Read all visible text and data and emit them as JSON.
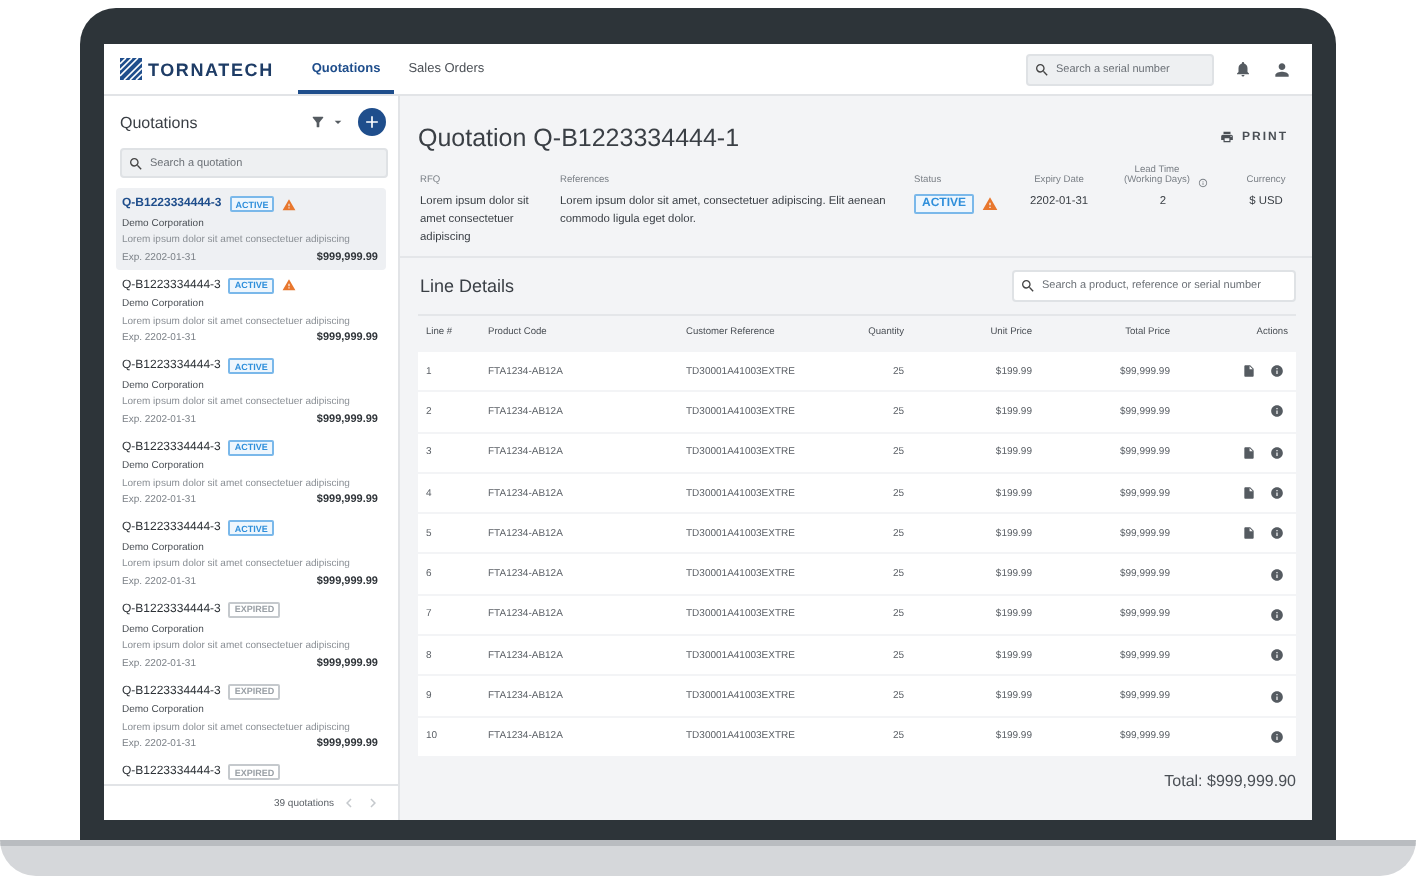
{
  "header": {
    "logo": "TORNATECH",
    "tabs": [
      {
        "label": "Quotations",
        "selected": true
      },
      {
        "label": "Sales Orders",
        "selected": false
      }
    ],
    "search": {
      "placeholder": "Search a serial number"
    }
  },
  "sidebar": {
    "title": "Quotations",
    "search": {
      "placeholder": "Search a quotation"
    },
    "items": [
      {
        "id": "Q-B1223334444-3",
        "status": {
          "kind": "active",
          "label": "ACTIVE"
        },
        "warning": true,
        "selected": true,
        "company": "Demo Corporation",
        "description": "Lorem ipsum dolor sit amet consectetuer adipiscing",
        "expiry": "Exp. 2202-01-31",
        "price": "$999,999.99"
      },
      {
        "id": "Q-B1223334444-3",
        "status": {
          "kind": "active",
          "label": "ACTIVE"
        },
        "warning": true,
        "selected": false,
        "company": "Demo Corporation",
        "description": "Lorem ipsum dolor sit amet consectetuer adipiscing",
        "expiry": "Exp. 2202-01-31",
        "price": "$999,999.99"
      },
      {
        "id": "Q-B1223334444-3",
        "status": {
          "kind": "active",
          "label": "ACTIVE"
        },
        "warning": false,
        "selected": false,
        "company": "Demo Corporation",
        "description": "Lorem ipsum dolor sit amet consectetuer adipiscing",
        "expiry": "Exp. 2202-01-31",
        "price": "$999,999.99"
      },
      {
        "id": "Q-B1223334444-3",
        "status": {
          "kind": "active",
          "label": "ACTIVE"
        },
        "warning": false,
        "selected": false,
        "company": "Demo Corporation",
        "description": "Lorem ipsum dolor sit amet consectetuer adipiscing",
        "expiry": "Exp. 2202-01-31",
        "price": "$999,999.99"
      },
      {
        "id": "Q-B1223334444-3",
        "status": {
          "kind": "active",
          "label": "ACTIVE"
        },
        "warning": false,
        "selected": false,
        "company": "Demo Corporation",
        "description": "Lorem ipsum dolor sit amet consectetuer adipiscing",
        "expiry": "Exp. 2202-01-31",
        "price": "$999,999.99"
      },
      {
        "id": "Q-B1223334444-3",
        "status": {
          "kind": "expired",
          "label": "EXPIRED"
        },
        "warning": false,
        "selected": false,
        "company": "Demo Corporation",
        "description": "Lorem ipsum dolor sit amet consectetuer adipiscing",
        "expiry": "Exp. 2202-01-31",
        "price": "$999,999.99"
      },
      {
        "id": "Q-B1223334444-3",
        "status": {
          "kind": "expired",
          "label": "EXPIRED"
        },
        "warning": false,
        "selected": false,
        "company": "Demo Corporation",
        "description": "Lorem ipsum dolor sit amet consectetuer adipiscing",
        "expiry": "Exp. 2202-01-31",
        "price": "$999,999.99"
      },
      {
        "id": "Q-B1223334444-3",
        "status": {
          "kind": "expired",
          "label": "EXPIRED"
        },
        "warning": false,
        "selected": false
      }
    ],
    "footer": {
      "count": "39 quotations"
    }
  },
  "quotation": {
    "title": "Quotation Q-B1223334444-1",
    "print": "PRINT",
    "fields": [
      {
        "kind": "text",
        "label": "RFQ",
        "value": "Lorem ipsum dolor sit amet consectetuer adipiscing"
      },
      {
        "kind": "text",
        "label": "References",
        "value": "Lorem ipsum dolor sit amet, consectetuer adipiscing. Elit aenean commodo ligula eget dolor."
      },
      {
        "kind": "status",
        "label": "Status",
        "status": {
          "kind": "active",
          "label": "ACTIVE"
        },
        "warning": true
      },
      {
        "kind": "text",
        "label": "Expiry Date",
        "value": "2202-01-31"
      },
      {
        "kind": "text",
        "label": "Lead Time (Working Days)",
        "value": "2",
        "info": true
      },
      {
        "kind": "text",
        "label": "Currency",
        "value": "$ USD"
      }
    ]
  },
  "line_details": {
    "title": "Line Details",
    "search": {
      "placeholder": "Search a product, reference or serial number"
    },
    "columns": [
      "Line #",
      "Product Code",
      "Customer Reference",
      "Quantity",
      "Unit Price",
      "Total Price",
      "Actions"
    ],
    "rows": [
      {
        "line": "1",
        "product_code": "FTA1234-AB12A",
        "customer_reference": "TD30001A41003EXTRE",
        "quantity": "25",
        "unit_price": "$199.99",
        "total_price": "$99,999.99",
        "document": true
      },
      {
        "line": "2",
        "product_code": "FTA1234-AB12A",
        "customer_reference": "TD30001A41003EXTRE",
        "quantity": "25",
        "unit_price": "$199.99",
        "total_price": "$99,999.99",
        "document": false
      },
      {
        "line": "3",
        "product_code": "FTA1234-AB12A",
        "customer_reference": "TD30001A41003EXTRE",
        "quantity": "25",
        "unit_price": "$199.99",
        "total_price": "$99,999.99",
        "document": true
      },
      {
        "line": "4",
        "product_code": "FTA1234-AB12A",
        "customer_reference": "TD30001A41003EXTRE",
        "quantity": "25",
        "unit_price": "$199.99",
        "total_price": "$99,999.99",
        "document": true
      },
      {
        "line": "5",
        "product_code": "FTA1234-AB12A",
        "customer_reference": "TD30001A41003EXTRE",
        "quantity": "25",
        "unit_price": "$199.99",
        "total_price": "$99,999.99",
        "document": true
      },
      {
        "line": "6",
        "product_code": "FTA1234-AB12A",
        "customer_reference": "TD30001A41003EXTRE",
        "quantity": "25",
        "unit_price": "$199.99",
        "total_price": "$99,999.99",
        "document": false
      },
      {
        "line": "7",
        "product_code": "FTA1234-AB12A",
        "customer_reference": "TD30001A41003EXTRE",
        "quantity": "25",
        "unit_price": "$199.99",
        "total_price": "$99,999.99",
        "document": false
      },
      {
        "line": "8",
        "product_code": "FTA1234-AB12A",
        "customer_reference": "TD30001A41003EXTRE",
        "quantity": "25",
        "unit_price": "$199.99",
        "total_price": "$99,999.99",
        "document": false
      },
      {
        "line": "9",
        "product_code": "FTA1234-AB12A",
        "customer_reference": "TD30001A41003EXTRE",
        "quantity": "25",
        "unit_price": "$199.99",
        "total_price": "$99,999.99",
        "document": false
      },
      {
        "line": "10",
        "product_code": "FTA1234-AB12A",
        "customer_reference": "TD30001A41003EXTRE",
        "quantity": "25",
        "unit_price": "$199.99",
        "total_price": "$99,999.99",
        "document": false
      }
    ],
    "total": "Total: $999,999.90"
  }
}
